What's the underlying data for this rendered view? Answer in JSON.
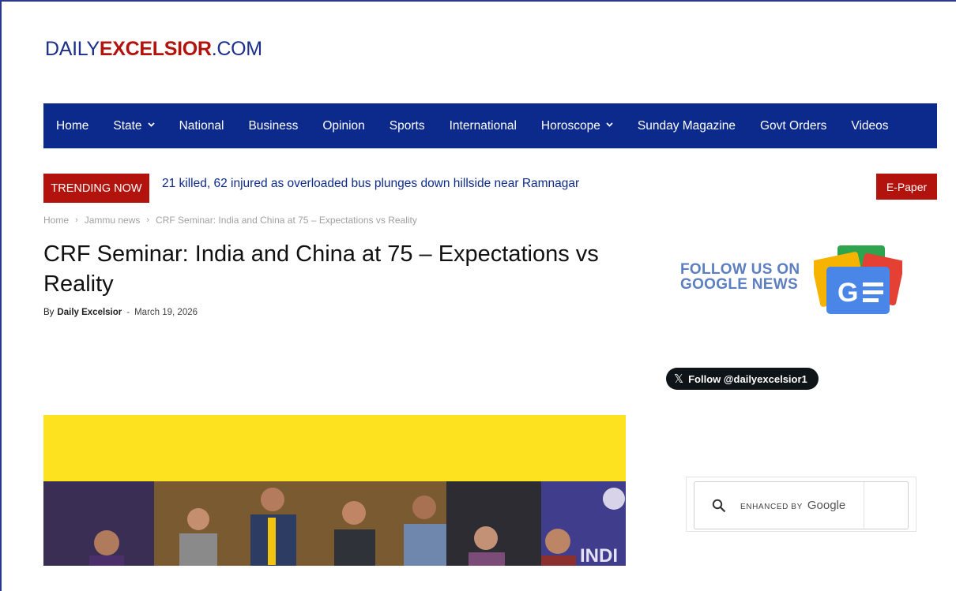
{
  "logo": {
    "part1": "DAILY",
    "part2": "EXCELSIOR",
    "part3": ".COM"
  },
  "nav": {
    "items": [
      {
        "label": "Home"
      },
      {
        "label": "State",
        "has_dropdown": true
      },
      {
        "label": "National"
      },
      {
        "label": "Business"
      },
      {
        "label": "Opinion"
      },
      {
        "label": "Sports"
      },
      {
        "label": "International"
      },
      {
        "label": "Horoscope",
        "has_dropdown": true
      },
      {
        "label": "Sunday Magazine"
      },
      {
        "label": "Govt Orders"
      },
      {
        "label": "Videos"
      }
    ],
    "background": "#0b2a8c"
  },
  "trending": {
    "badge": "TRENDING NOW",
    "headline": "21 killed, 62 injured as overloaded bus plunges down hillside near Ramnagar"
  },
  "epaper": "E-Paper",
  "breadcrumb": {
    "items": [
      "Home",
      "Jammu news",
      "CRF Seminar: India and China at 75 – Expectations vs Reality"
    ],
    "separator": "›"
  },
  "article": {
    "title": "CRF Seminar: India and China at 75 – Expectations vs Reality",
    "by": "By",
    "author": "Daily Excelsior",
    "dash": "-",
    "date": "March 19, 2026"
  },
  "sidebar": {
    "gnews_line1": "FOLLOW US ON",
    "gnews_line2": "GOOGLE NEWS",
    "gnews_icon_text": "G",
    "x_follow": "Follow @dailyexcelsior1",
    "x_glyph": "𝕏",
    "search_enhanced": "ENHANCED BY",
    "search_google": "Google",
    "photo_banner_text": "INDI"
  },
  "colors": {
    "brand_red": "#b2140d",
    "brand_blue": "#1c2f8a",
    "photo_yellow": "#fde31f"
  }
}
